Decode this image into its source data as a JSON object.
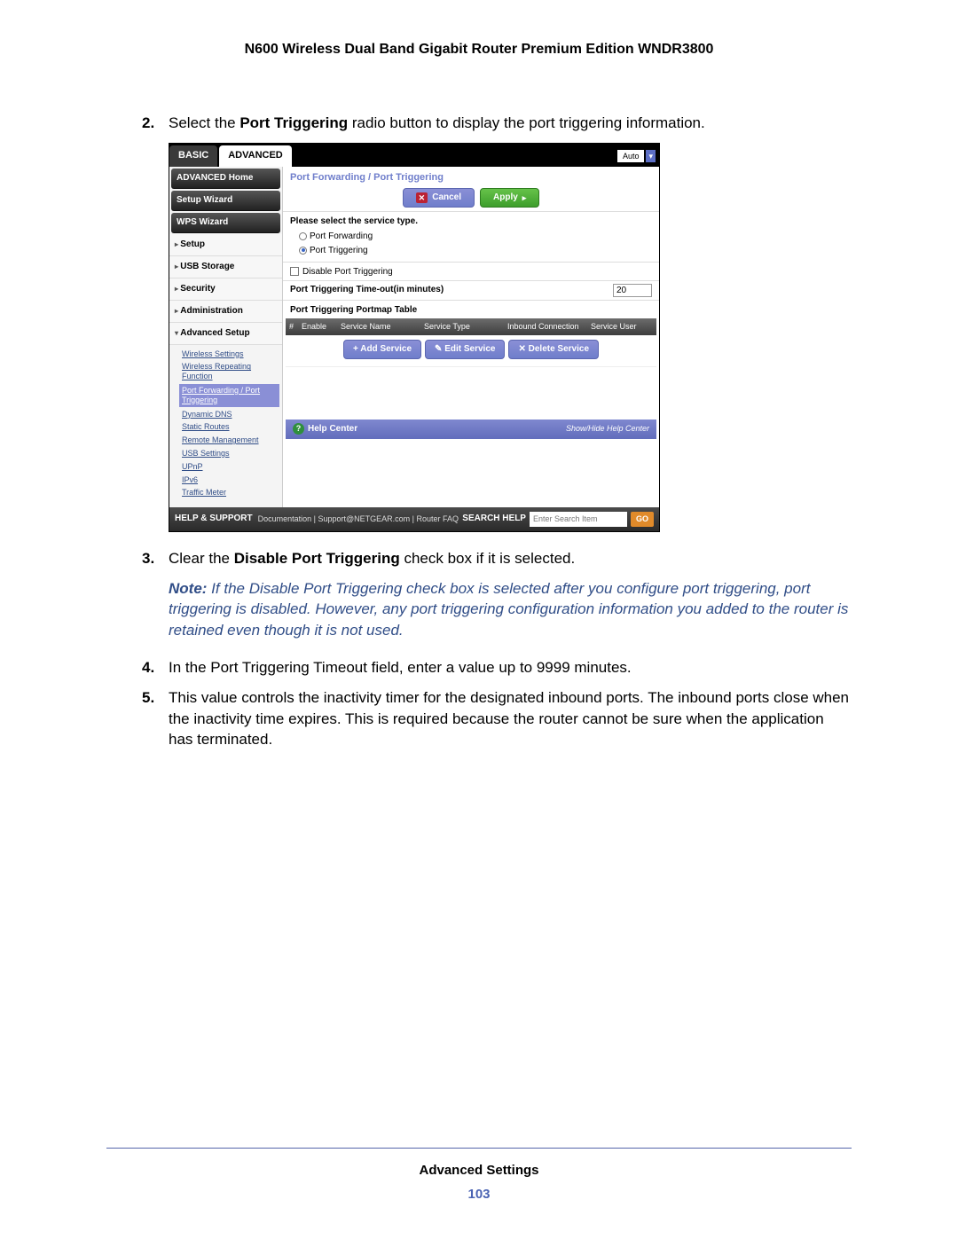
{
  "doc": {
    "header_title": "N600 Wireless Dual Band Gigabit Router Premium Edition WNDR3800",
    "footer_section": "Advanced Settings",
    "page_number": "103"
  },
  "steps": {
    "s2": {
      "num": "2.",
      "pre": "Select the ",
      "bold": "Port Triggering",
      "post": " radio button to display the port triggering information."
    },
    "s3": {
      "num": "3.",
      "pre": "Clear the ",
      "bold": "Disable Port Triggering",
      "post": " check box if it is selected."
    },
    "note": {
      "label": "Note:",
      "text": "  If the Disable Port Triggering check box is selected after you configure port triggering, port triggering is disabled. However, any port triggering configuration information you added to the router is retained even though it is not used."
    },
    "s4": {
      "num": "4.",
      "text": "In the Port Triggering Timeout field, enter a value up to 9999 minutes."
    },
    "s5": {
      "num": "5.",
      "text": "This value controls the inactivity timer for the designated inbound ports. The inbound ports close when the inactivity time expires. This is required because the router cannot be sure when the application has terminated."
    }
  },
  "ui": {
    "tabs": {
      "basic": "BASIC",
      "advanced": "ADVANCED"
    },
    "auto": "Auto",
    "sidebar": {
      "home": "ADVANCED Home",
      "wizard": "Setup Wizard",
      "wps": "WPS Wizard",
      "rows": {
        "setup": "Setup",
        "usb": "USB Storage",
        "security": "Security",
        "admin": "Administration",
        "advsetup": "Advanced Setup"
      },
      "sub": {
        "wireless": "Wireless Settings",
        "repeat": "Wireless Repeating Function",
        "portfwd": "Port Forwarding / Port Triggering",
        "ddns": "Dynamic DNS",
        "static": "Static Routes",
        "remote": "Remote Management",
        "usbset": "USB Settings",
        "upnp": "UPnP",
        "ipv6": "IPv6",
        "traffic": "Traffic Meter"
      }
    },
    "main": {
      "title": "Port Forwarding / Port Triggering",
      "cancel": "Cancel",
      "apply": "Apply",
      "select_label": "Please select the service type.",
      "opt_fwd": "Port Forwarding",
      "opt_trg": "Port Triggering",
      "disable_label": "Disable Port Triggering",
      "timeout_label": "Port Triggering Time-out(in minutes)",
      "timeout_value": "20",
      "table_title": "Port Triggering Portmap Table",
      "cols": {
        "num": "#",
        "enable": "Enable",
        "service": "Service Name",
        "type": "Service Type",
        "inbound": "Inbound Connection",
        "user": "Service User"
      },
      "btn_add": "+  Add Service",
      "btn_edit": "✎  Edit Service",
      "btn_del": "✕  Delete Service",
      "help_center": "Help Center",
      "show_hide": "Show/Hide Help Center"
    },
    "footer": {
      "help_support": "HELP & SUPPORT",
      "links": "Documentation | Support@NETGEAR.com | Router FAQ",
      "search_label": "SEARCH HELP",
      "search_placeholder": "Enter Search Item",
      "go": "GO"
    }
  }
}
